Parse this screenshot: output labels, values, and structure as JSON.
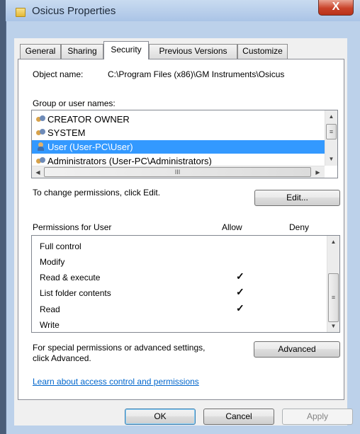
{
  "window": {
    "title": "Osicus Properties",
    "close_glyph": "X"
  },
  "tabs": [
    {
      "label": "General",
      "active": false
    },
    {
      "label": "Sharing",
      "active": false
    },
    {
      "label": "Security",
      "active": true
    },
    {
      "label": "Previous Versions",
      "active": false
    },
    {
      "label": "Customize",
      "active": false
    }
  ],
  "security": {
    "object_name_label": "Object name:",
    "object_name_value": "C:\\Program Files (x86)\\GM Instruments\\Osicus",
    "group_label": "Group or user names:",
    "users": [
      {
        "name": "CREATOR OWNER",
        "icon": "group-icon",
        "selected": false
      },
      {
        "name": "SYSTEM",
        "icon": "group-icon",
        "selected": false
      },
      {
        "name": "User (User-PC\\User)",
        "icon": "user-icon",
        "selected": true
      },
      {
        "name": "Administrators (User-PC\\Administrators)",
        "icon": "group-icon",
        "selected": false
      }
    ],
    "change_text": "To change permissions, click Edit.",
    "edit_label": "Edit...",
    "permissions_label": "Permissions for User",
    "allow_header": "Allow",
    "deny_header": "Deny",
    "permissions": [
      {
        "name": "Full control",
        "allow": false,
        "deny": false
      },
      {
        "name": "Modify",
        "allow": false,
        "deny": false
      },
      {
        "name": "Read & execute",
        "allow": true,
        "deny": false
      },
      {
        "name": "List folder contents",
        "allow": true,
        "deny": false
      },
      {
        "name": "Read",
        "allow": true,
        "deny": false
      },
      {
        "name": "Write",
        "allow": false,
        "deny": false
      }
    ],
    "check_glyph": "✓",
    "special_text_line1": "For special permissions or advanced settings,",
    "special_text_line2": "click Advanced.",
    "advanced_label": "Advanced",
    "learn_link": "Learn about access control and permissions"
  },
  "buttons": {
    "ok": "OK",
    "cancel": "Cancel",
    "apply": "Apply"
  },
  "scroll_glyphs": {
    "up": "▲",
    "down": "▼",
    "left": "◀",
    "right": "▶",
    "grip_v": "≡",
    "grip_h": "III"
  },
  "colors": {
    "selection": "#3399ff",
    "link": "#0066cc",
    "titlebar": "#bcd1ea"
  }
}
